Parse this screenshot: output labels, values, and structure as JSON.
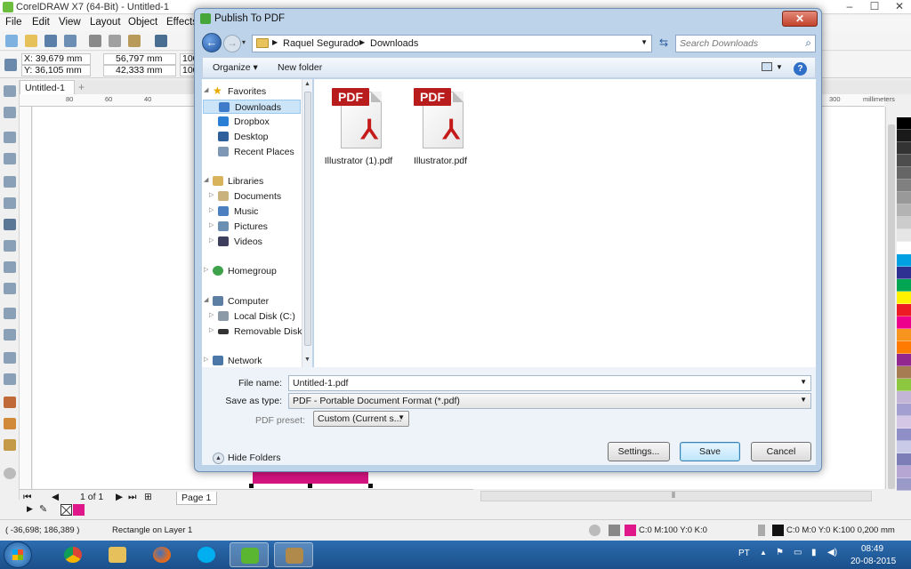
{
  "app": {
    "title": "CorelDRAW X7 (64-Bit) - Untitled-1",
    "menu": [
      "File",
      "Edit",
      "View",
      "Layout",
      "Object",
      "Effects"
    ],
    "coords": {
      "x": "X: 39,679 mm",
      "y": "Y: 36,105 mm",
      "w": "56,797 mm",
      "h": "42,333 mm",
      "sx": "100",
      "sy": "100"
    },
    "doc_tab": "Untitled-1",
    "ruler_top": [
      "80",
      "60",
      "40",
      "300",
      "millimeters"
    ],
    "ruler_left_unit": "millimeters",
    "page_nav": {
      "page_count": "1 of 1",
      "page_tab": "Page 1"
    },
    "status": {
      "cursor": "( -36,698; 186,389 )",
      "object": "Rectangle on Layer 1",
      "fill": "C:0 M:100 Y:0 K:0",
      "outline": "C:0 M:0 Y:0 K:100  0,200 mm"
    },
    "palette": [
      "#000000",
      "#1a1a1a",
      "#333333",
      "#4d4d4d",
      "#666666",
      "#808080",
      "#999999",
      "#b3b3b3",
      "#cccccc",
      "#e6e6e6",
      "#ffffff",
      "#00a0e3",
      "#2e3192",
      "#00a651",
      "#fff200",
      "#ed1c24",
      "#ec008c",
      "#f7941d",
      "#ff7a00",
      "#92278f",
      "#a67c52",
      "#8dc63f",
      "#c2b5d6",
      "#a39fd0",
      "#d4c7e6",
      "#8f8fc8",
      "#c9c9e8",
      "#7d7db8",
      "#b5a6d4",
      "#9a9ac8"
    ],
    "accent": "#d4147f"
  },
  "dialog": {
    "title": "Publish To PDF",
    "close": "✕",
    "path": [
      "Raquel Segurado",
      "Downloads"
    ],
    "search_placeholder": "Search Downloads",
    "organize": "Organize ▾",
    "new_folder": "New folder",
    "nav": [
      {
        "label": "Favorites",
        "icon": "star-icon",
        "level": 0,
        "expanded": true
      },
      {
        "label": "Downloads",
        "icon": "downloads-folder-icon",
        "level": 1,
        "selected": true
      },
      {
        "label": "Dropbox",
        "icon": "dropbox-icon",
        "level": 1
      },
      {
        "label": "Desktop",
        "icon": "desktop-icon",
        "level": 1
      },
      {
        "label": "Recent Places",
        "icon": "recent-places-icon",
        "level": 1
      },
      {
        "label": "Libraries",
        "icon": "libraries-icon",
        "level": 0,
        "expanded": true
      },
      {
        "label": "Documents",
        "icon": "documents-icon",
        "level": 1
      },
      {
        "label": "Music",
        "icon": "music-icon",
        "level": 1
      },
      {
        "label": "Pictures",
        "icon": "pictures-icon",
        "level": 1
      },
      {
        "label": "Videos",
        "icon": "videos-icon",
        "level": 1
      },
      {
        "label": "Homegroup",
        "icon": "homegroup-icon",
        "level": 0
      },
      {
        "label": "Computer",
        "icon": "computer-icon",
        "level": 0,
        "expanded": true
      },
      {
        "label": "Local Disk (C:)",
        "icon": "local-disk-icon",
        "level": 1
      },
      {
        "label": "Removable Disk (",
        "icon": "removable-disk-icon",
        "level": 1
      },
      {
        "label": "Network",
        "icon": "network-icon",
        "level": 0
      }
    ],
    "files": [
      {
        "name": "Illustrator (1).pdf",
        "badge": "PDF"
      },
      {
        "name": "Illustrator.pdf",
        "badge": "PDF"
      }
    ],
    "file_name_label": "File name:",
    "file_name_value": "Untitled-1.pdf",
    "save_type_label": "Save as type:",
    "save_type_value": "PDF - Portable Document Format (*.pdf)",
    "preset_label": "PDF preset:",
    "preset_value": "Custom (Current s...",
    "hide_folders": "Hide Folders",
    "settings_btn": "Settings...",
    "save_btn": "Save",
    "cancel_btn": "Cancel"
  },
  "taskbar": {
    "apps": [
      "start",
      "chrome",
      "explorer",
      "firefox",
      "skype",
      "coreldraw",
      "corel-paint"
    ],
    "lang": "PT",
    "time": "08:49",
    "date": "20-08-2015"
  }
}
